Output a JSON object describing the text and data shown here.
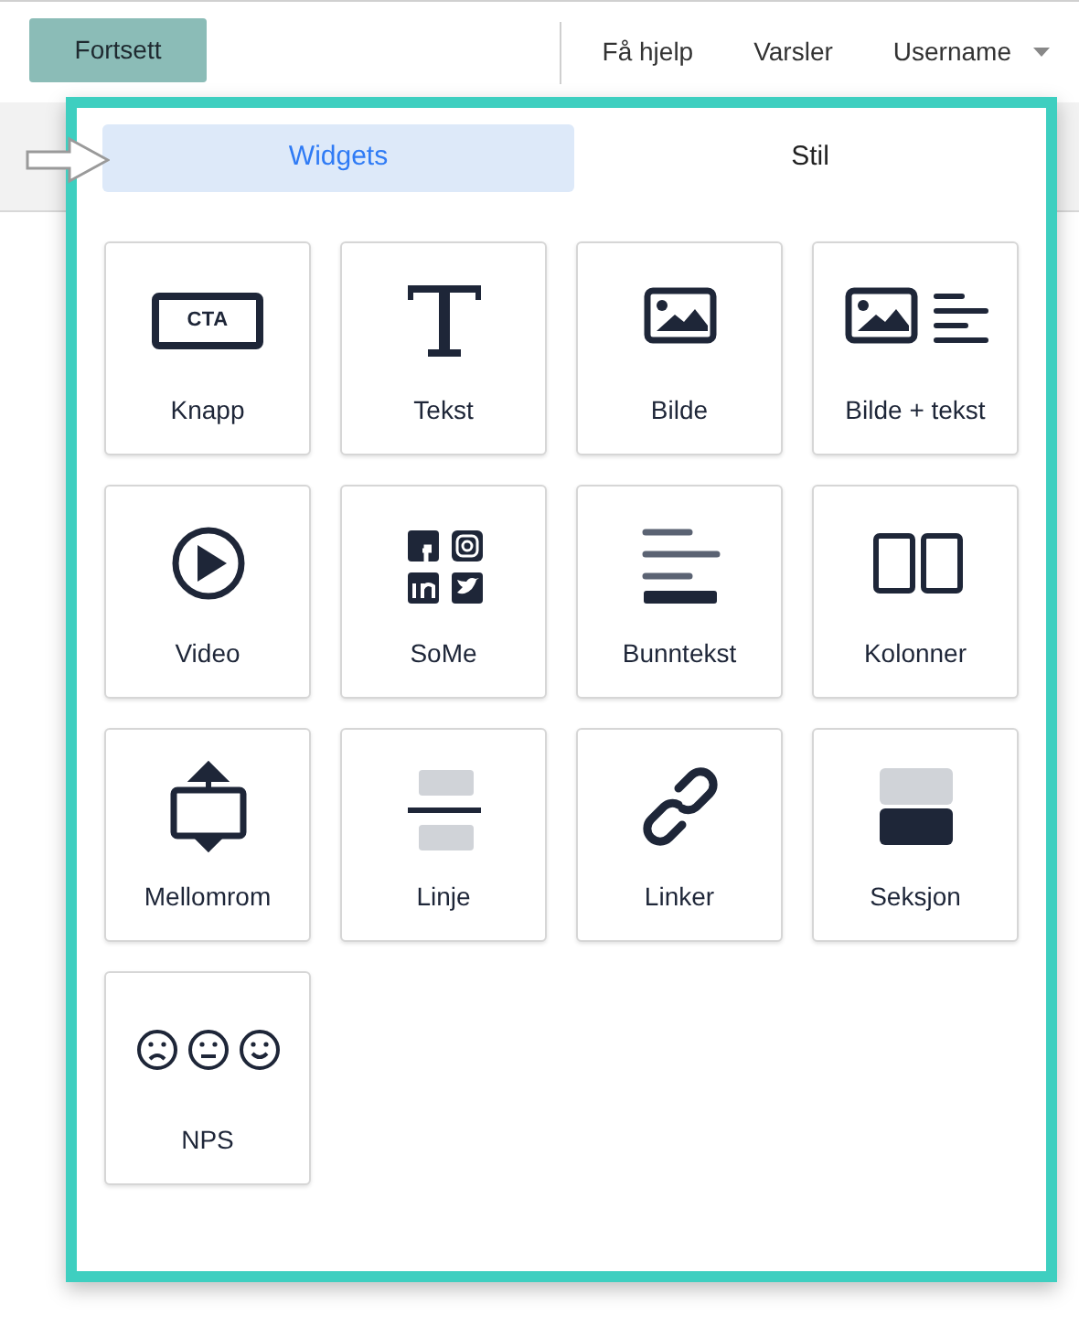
{
  "header": {
    "continue_button": "Fortsett",
    "links": [
      "Få hjelp",
      "Varsler"
    ],
    "user_menu": "Username"
  },
  "panel": {
    "tabs": [
      {
        "label": "Widgets",
        "selected": true
      },
      {
        "label": "Stil",
        "selected": false
      }
    ],
    "widgets": [
      {
        "label": "Knapp",
        "kind": "button",
        "icon_text": "CTA"
      },
      {
        "label": "Tekst",
        "kind": "text"
      },
      {
        "label": "Bilde",
        "kind": "image"
      },
      {
        "label": "Bilde + tekst",
        "kind": "image_text"
      },
      {
        "label": "Video",
        "kind": "video"
      },
      {
        "label": "SoMe",
        "kind": "social"
      },
      {
        "label": "Bunntekst",
        "kind": "footer"
      },
      {
        "label": "Kolonner",
        "kind": "columns"
      },
      {
        "label": "Mellomrom",
        "kind": "spacer"
      },
      {
        "label": "Linje",
        "kind": "divider"
      },
      {
        "label": "Linker",
        "kind": "link"
      },
      {
        "label": "Seksjon",
        "kind": "section"
      },
      {
        "label": "NPS",
        "kind": "nps"
      }
    ]
  }
}
